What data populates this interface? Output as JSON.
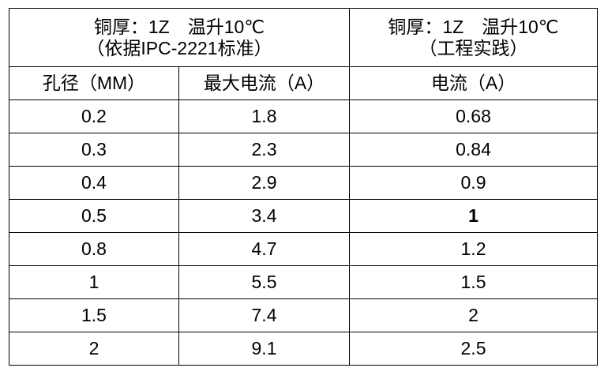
{
  "header": {
    "left": {
      "line1": "铜厚：1Z　温升10℃",
      "line2": "（依据IPC-2221标准）"
    },
    "right": {
      "line1": "铜厚：1Z　温升10℃",
      "line2": "（工程实践）"
    }
  },
  "columns": [
    "孔径（MM）",
    "最大电流（A）",
    "电流（A）"
  ],
  "rows": [
    [
      "0.2",
      "1.8",
      "0.68"
    ],
    [
      "0.3",
      "2.3",
      "0.84"
    ],
    [
      "0.4",
      "2.9",
      "0.9"
    ],
    [
      "0.5",
      "3.4",
      "1"
    ],
    [
      "0.8",
      "4.7",
      "1.2"
    ],
    [
      "1",
      "5.5",
      "1.5"
    ],
    [
      "1.5",
      "7.4",
      "2"
    ],
    [
      "2",
      "9.1",
      "2.5"
    ]
  ],
  "bold_cells": [
    "rows.3.2"
  ]
}
